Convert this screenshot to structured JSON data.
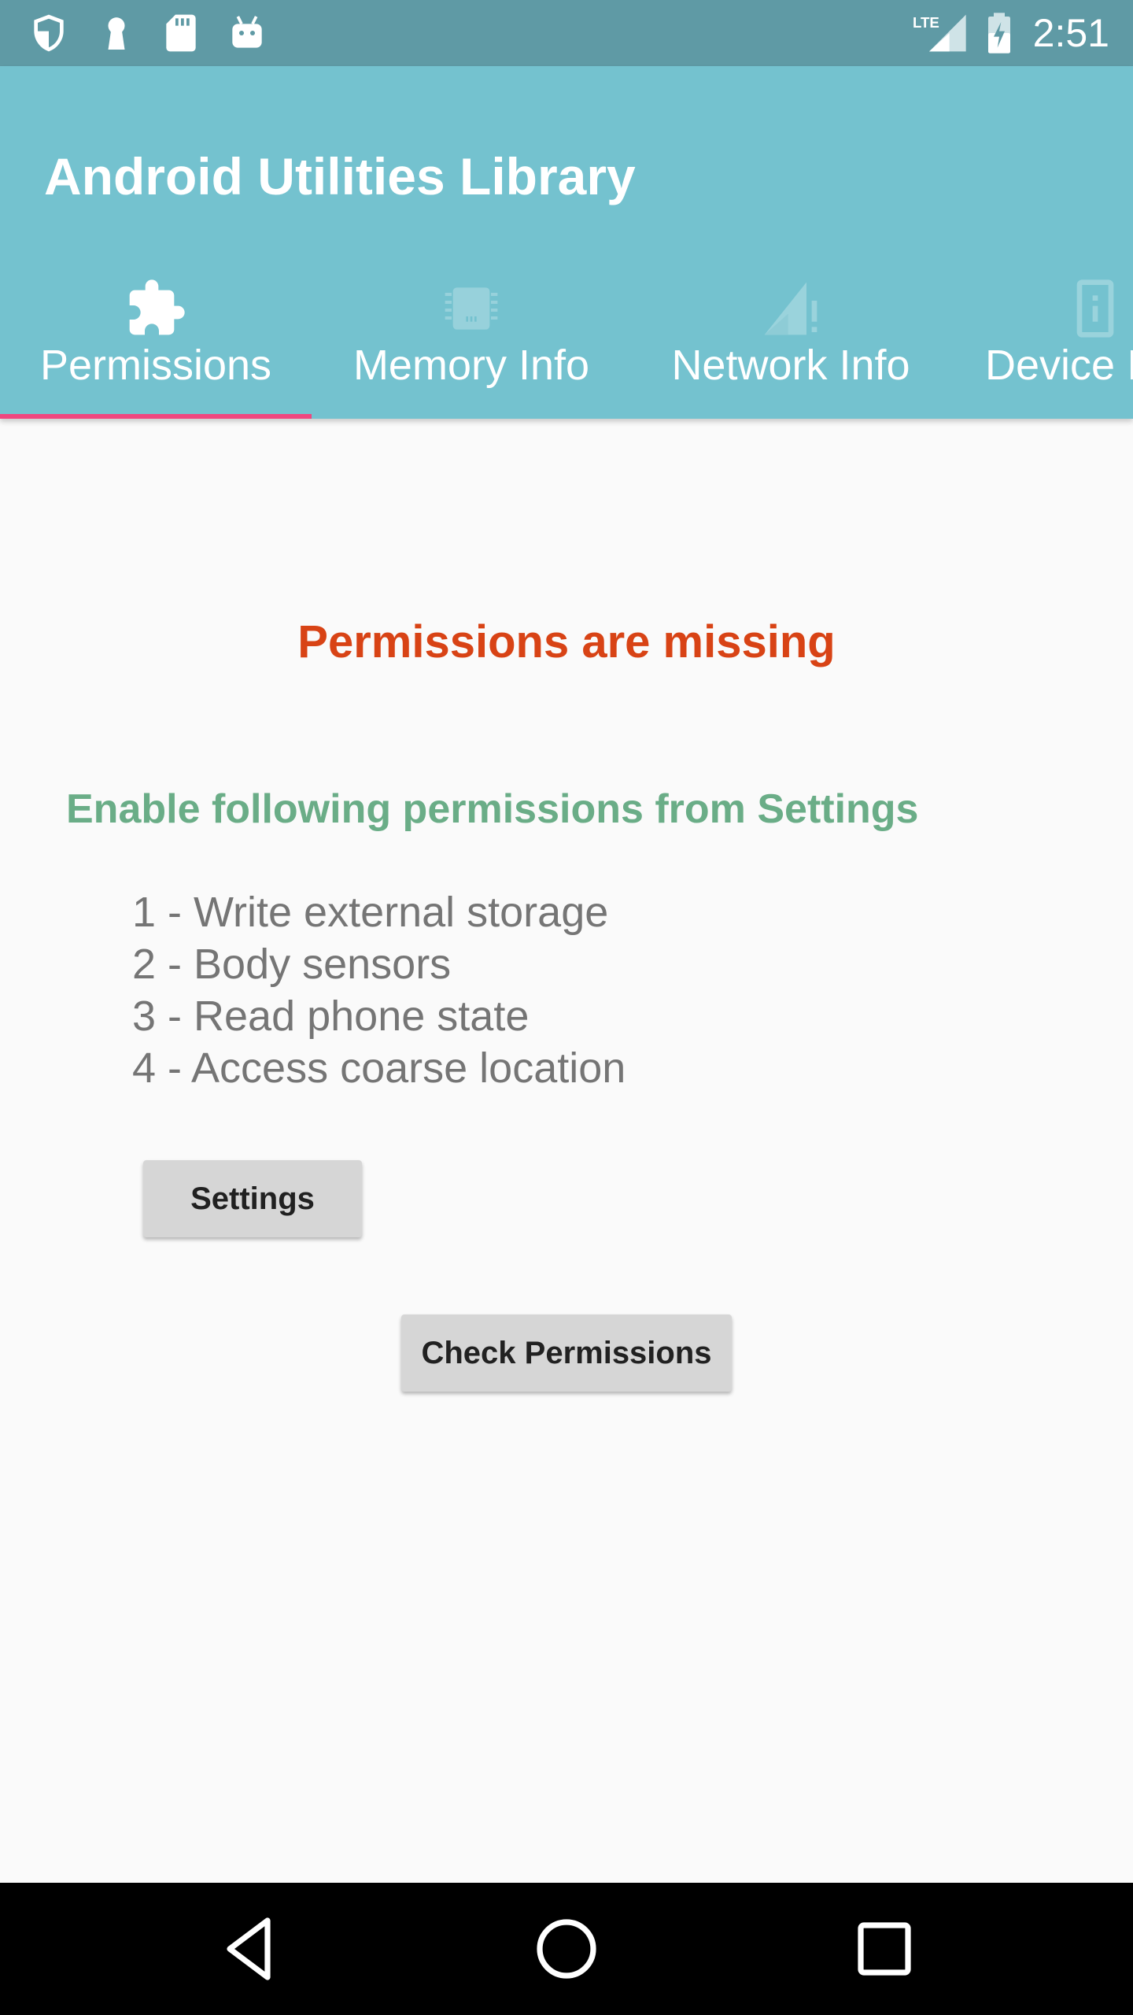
{
  "status_bar": {
    "time": "2:51",
    "left_icons": [
      "shield-icon",
      "keyhole-icon",
      "sd-card-icon",
      "android-icon"
    ],
    "right_icons": [
      "lte-signal-icon",
      "battery-charging-icon"
    ]
  },
  "app_bar": {
    "title": "Android Utilities Library",
    "background_color": "#74c2cf"
  },
  "tabs": [
    {
      "label": "Permissions",
      "icon": "puzzle-icon",
      "selected": true
    },
    {
      "label": "Memory Info",
      "icon": "memory-chip-icon",
      "selected": false
    },
    {
      "label": "Network Info",
      "icon": "signal-alert-icon",
      "selected": false
    },
    {
      "label": "Device Info",
      "icon": "device-icon",
      "selected": false
    }
  ],
  "tab_indicator_color": "#f0467f",
  "content": {
    "missing_title": "Permissions are missing",
    "missing_title_color": "#d84315",
    "enable_text": "Enable following permissions from Settings",
    "enable_text_color": "#6aad87",
    "permissions": [
      "1 - Write external storage",
      "2 - Body sensors",
      "3 - Read phone state",
      "4 - Access coarse location"
    ],
    "settings_button": "Settings",
    "check_button": "Check Permissions"
  },
  "nav_bar": {
    "buttons": [
      "back-icon",
      "home-icon",
      "recents-icon"
    ]
  }
}
